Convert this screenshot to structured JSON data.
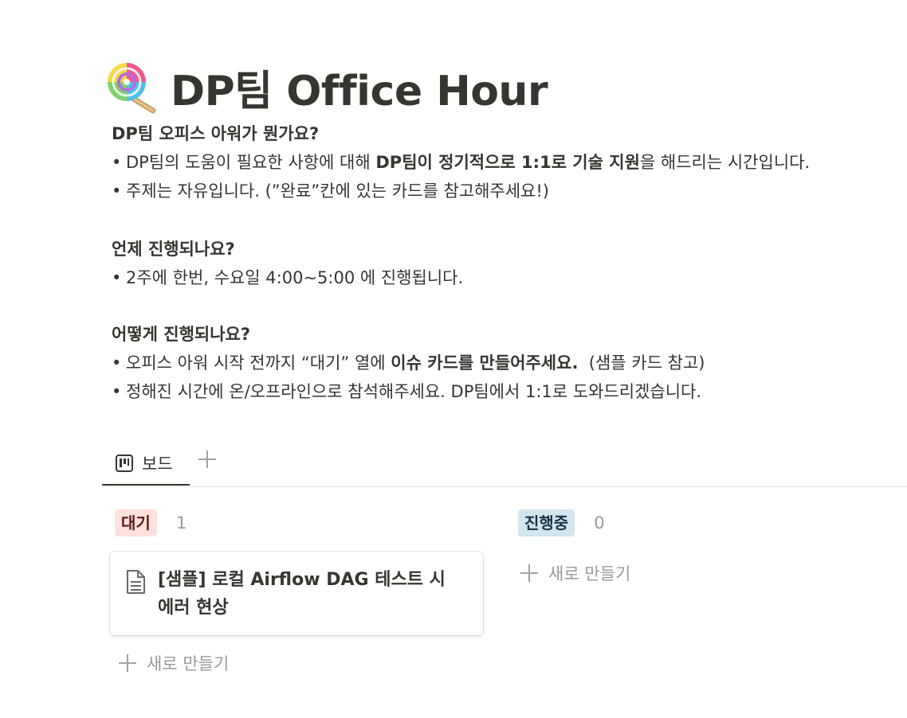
{
  "page": {
    "title": "DP팀 Office Hour",
    "icon": "lollipop-icon"
  },
  "intro": {
    "heading": "DP팀 오피스 아워가 뭔가요?",
    "bullet1_pre": "DP팀의 도움이 필요한 사항에 대해 ",
    "bullet1_bold": "DP팀이 정기적으로 1:1로 기술 지원",
    "bullet1_post": "을 해드리는 시간입니다.",
    "bullet2": "주제는 자유입니다. (”완료”칸에 있는 카드를 참고해주세요!)"
  },
  "when": {
    "heading": "언제 진행되나요?",
    "bullet1": "2주에 한번, 수요일 4:00~5:00 에 진행됩니다."
  },
  "how": {
    "heading": "어떻게 진행되나요?",
    "bullet1_pre": "오피스 아워 시작 전까지 “대기” 열에 ",
    "bullet1_bold": "이슈 카드를 만들어주세요.",
    "bullet1_post": "  (샘플 카드 참고)",
    "bullet2": "정해진 시간에 온/오프라인으로 참석해주세요. DP팀에서 1:1로 도와드리겠습니다."
  },
  "views": {
    "active_tab": "보드",
    "tab_icon": "board-icon",
    "add_icon": "plus-icon"
  },
  "board": {
    "columns": [
      {
        "status": "대기",
        "count": "1",
        "color": "#ffe2dd",
        "text_color": "#5d1715",
        "cards": [
          {
            "title": "[샘플] 로컬 Airflow DAG 테스트 시 에러 현상",
            "icon": "document-icon"
          }
        ],
        "new_label": "새로 만들기"
      },
      {
        "status": "진행중",
        "count": "0",
        "color": "#d3e5ef",
        "text_color": "#183347",
        "cards": [],
        "new_label": "새로 만들기"
      }
    ]
  }
}
